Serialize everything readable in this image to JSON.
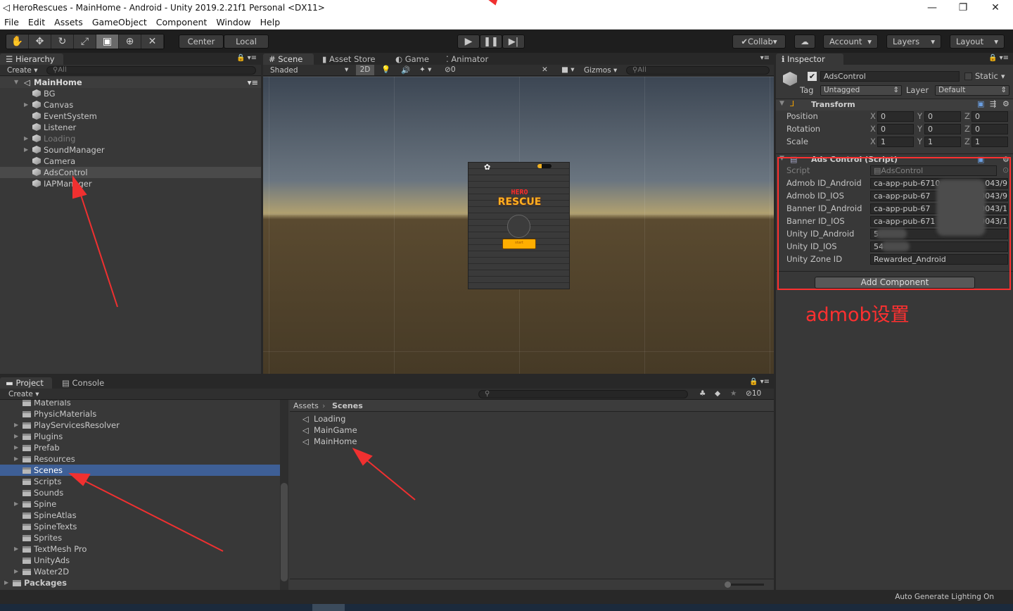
{
  "window": {
    "title": "HeroRescues - MainHome - Android - Unity 2019.2.21f1 Personal <DX11>",
    "minimize": "—",
    "restore": "❐",
    "close": "✕"
  },
  "menu": [
    "File",
    "Edit",
    "Assets",
    "GameObject",
    "Component",
    "Window",
    "Help"
  ],
  "toolbar": {
    "tools": [
      "hand-tool",
      "move-tool",
      "rotate-tool",
      "scale-tool",
      "rect-tool",
      "transform-tool",
      "custom-tool"
    ],
    "active_tool": "rect-tool",
    "pivot": "Center",
    "space": "Local",
    "collab": "Collab",
    "account": "Account",
    "layers": "Layers",
    "layout": "Layout"
  },
  "hierarchy": {
    "tab": "Hierarchy",
    "create": "Create",
    "search_placeholder": "All",
    "scene": "MainHome",
    "items": [
      {
        "label": "BG",
        "expand": false
      },
      {
        "label": "Canvas",
        "expand": true
      },
      {
        "label": "EventSystem",
        "expand": false
      },
      {
        "label": "Listener",
        "expand": false
      },
      {
        "label": "Loading",
        "expand": true,
        "disabled": true
      },
      {
        "label": "SoundManager",
        "expand": true
      },
      {
        "label": "Camera",
        "expand": false
      },
      {
        "label": "AdsControl",
        "expand": false,
        "selected": true
      },
      {
        "label": "IAPManager",
        "expand": false
      }
    ]
  },
  "scene": {
    "tabs": [
      "Scene",
      "Asset Store",
      "Game",
      "Animator"
    ],
    "shading": "Shaded",
    "mode_2d": "2D",
    "hidden_count": "0",
    "gizmos": "Gizmos",
    "search_placeholder": "All",
    "game_logo_top": "HERO",
    "game_logo_bottom": "RESCUE",
    "start_button": "start"
  },
  "inspector": {
    "tab": "Inspector",
    "object_name": "AdsControl",
    "static_label": "Static",
    "tag_label": "Tag",
    "tag": "Untagged",
    "layer_label": "Layer",
    "layer": "Default",
    "transform": {
      "title": "Transform",
      "rows": [
        {
          "label": "Position",
          "x": "0",
          "y": "0",
          "z": "0"
        },
        {
          "label": "Rotation",
          "x": "0",
          "y": "0",
          "z": "0"
        },
        {
          "label": "Scale",
          "x": "1",
          "y": "1",
          "z": "1"
        }
      ]
    },
    "script_component": {
      "title": "Ads Control (Script)",
      "script_label": "Script",
      "script_value": "AdsControl",
      "fields": [
        {
          "label": "Admob ID_Android",
          "value": "ca-app-pub-6710",
          "suffix": "043/9"
        },
        {
          "label": "Admob ID_IOS",
          "value": "ca-app-pub-67",
          "suffix": "00043/9"
        },
        {
          "label": "Banner ID_Android",
          "value": "ca-app-pub-67",
          "suffix": "0043/1"
        },
        {
          "label": "Banner ID_IOS",
          "value": "ca-app-pub-671",
          "suffix": "09043/1"
        },
        {
          "label": "Unity ID_Android",
          "value": "5",
          "suffix": ""
        },
        {
          "label": "Unity ID_IOS",
          "value": "54",
          "suffix": ""
        },
        {
          "label": "Unity Zone ID",
          "value": "Rewarded_Android",
          "suffix": ""
        }
      ]
    },
    "add_component": "Add Component"
  },
  "project": {
    "tabs": [
      "Project",
      "Console"
    ],
    "create": "Create",
    "hidden_count": "10",
    "tree": [
      {
        "label": "Materials",
        "expand": false
      },
      {
        "label": "PhysicMaterials",
        "expand": false
      },
      {
        "label": "PlayServicesResolver",
        "expand": true
      },
      {
        "label": "Plugins",
        "expand": true
      },
      {
        "label": "Prefab",
        "expand": true
      },
      {
        "label": "Resources",
        "expand": true
      },
      {
        "label": "Scenes",
        "expand": false,
        "selected": true
      },
      {
        "label": "Scripts",
        "expand": false
      },
      {
        "label": "Sounds",
        "expand": false
      },
      {
        "label": "Spine",
        "expand": true
      },
      {
        "label": "SpineAtlas",
        "expand": false
      },
      {
        "label": "SpineTexts",
        "expand": false
      },
      {
        "label": "Sprites",
        "expand": false
      },
      {
        "label": "TextMesh Pro",
        "expand": true
      },
      {
        "label": "UnityAds",
        "expand": false
      },
      {
        "label": "Water2D",
        "expand": true
      }
    ],
    "packages": "Packages",
    "breadcrumb": [
      "Assets",
      "Scenes"
    ],
    "files": [
      "Loading",
      "MainGame",
      "MainHome"
    ]
  },
  "status": {
    "text": "Auto Generate Lighting On"
  },
  "annotation": {
    "text": "admob设置",
    "color": "#ff3030"
  }
}
